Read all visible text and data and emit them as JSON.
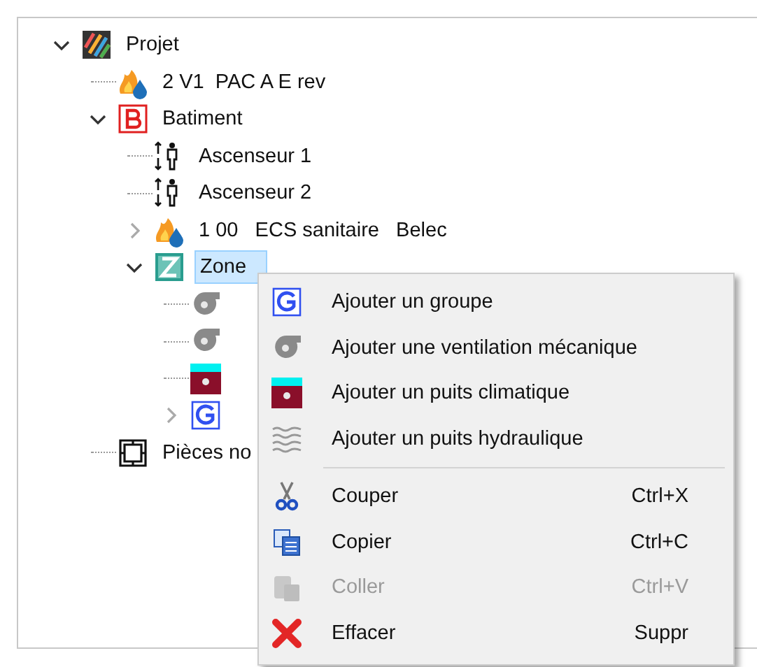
{
  "tree": [
    {
      "label": "Projet",
      "kind": "project",
      "expanded": true,
      "selected": false,
      "children": [
        {
          "label": "2 V1  PAC A E rev",
          "kind": "heatpump",
          "selected": false
        },
        {
          "label": "Batiment",
          "kind": "building",
          "expanded": true,
          "selected": false,
          "children": [
            {
              "label": "Ascenseur 1",
              "kind": "elevator",
              "selected": false
            },
            {
              "label": "Ascenseur 2",
              "kind": "elevator",
              "selected": false
            },
            {
              "label": "1 00   ECS sanitaire   Belec",
              "kind": "heatpump",
              "expanded": false,
              "selected": false
            },
            {
              "label": "Zone",
              "kind": "zone",
              "expanded": true,
              "selected": true,
              "children": [
                {
                  "kind": "fan",
                  "selected": false
                },
                {
                  "kind": "fan",
                  "selected": false
                },
                {
                  "kind": "well",
                  "selected": false
                },
                {
                  "kind": "group",
                  "expanded": false,
                  "selected": false
                }
              ]
            }
          ]
        },
        {
          "label": "Pièces no",
          "kind": "rooms",
          "selected": false
        }
      ]
    }
  ],
  "context_menu": [
    {
      "kind": "group",
      "label": "Ajouter un groupe",
      "disabled": false
    },
    {
      "kind": "fan",
      "label": "Ajouter une ventilation mécanique",
      "disabled": false
    },
    {
      "kind": "well",
      "label": "Ajouter un puits climatique",
      "disabled": false
    },
    {
      "kind": "hydraulic",
      "label": "Ajouter un puits hydraulique",
      "disabled": false
    },
    {
      "kind": "separator"
    },
    {
      "kind": "cut",
      "label": "Couper",
      "shortcut": "Ctrl+X",
      "disabled": false
    },
    {
      "kind": "copy",
      "label": "Copier",
      "shortcut": "Ctrl+C",
      "disabled": false
    },
    {
      "kind": "paste",
      "label": "Coller",
      "shortcut": "Ctrl+V",
      "disabled": true
    },
    {
      "kind": "delete",
      "label": "Effacer",
      "shortcut": "Suppr",
      "disabled": false
    }
  ]
}
